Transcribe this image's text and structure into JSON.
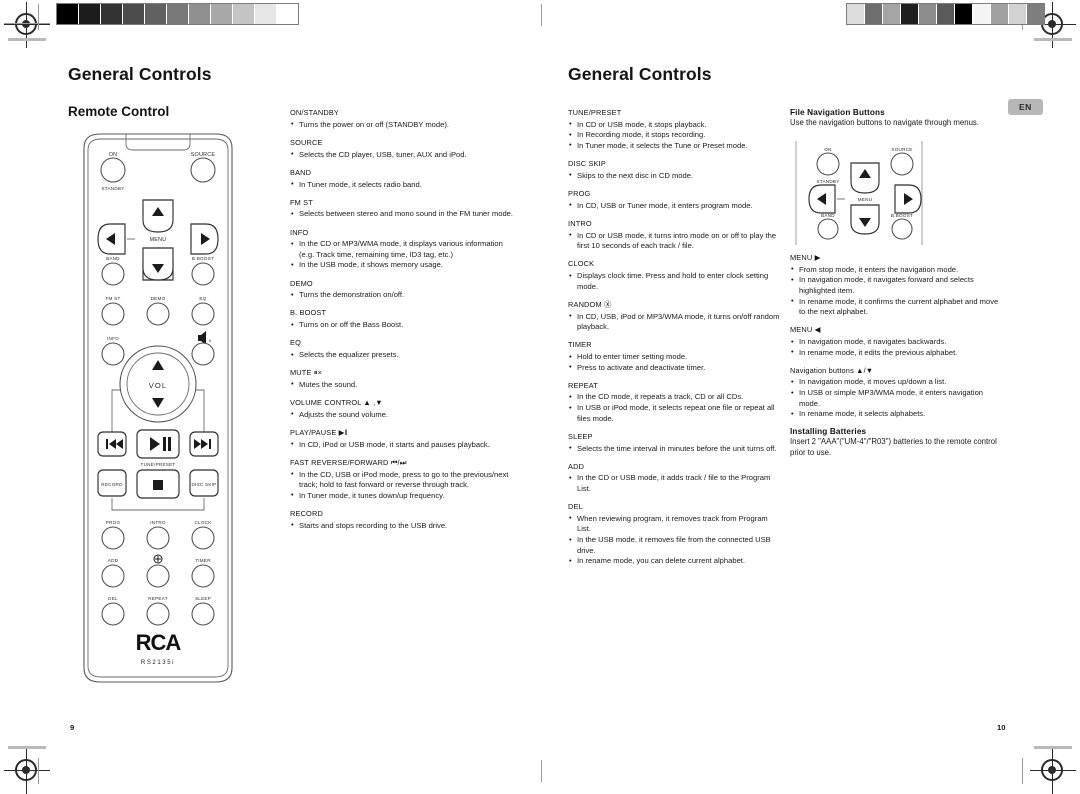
{
  "document": {
    "left_page_number": "9",
    "right_page_number": "10",
    "language_badge": "EN"
  },
  "left_page": {
    "title": "General Controls",
    "subtitle": "Remote Control",
    "remote": {
      "brand": "RCA",
      "model": "RS2135i",
      "labels": {
        "on": "ON",
        "standby": "STANDBY",
        "source": "SOURCE",
        "menu": "MENU",
        "band": "BAND",
        "bboost": "B.BOOST",
        "fmst": "FM ST",
        "demo": "DEMO",
        "eq": "EQ",
        "info": "INFO",
        "mute": "MUTE",
        "vol": "VOL",
        "tunepreset": "TUNE/PRESET",
        "record": "RECORD",
        "discskip": "DISC SKIP",
        "prog": "PROG",
        "intro": "INTRO",
        "clock": "CLOCK",
        "add": "ADD",
        "random": "RANDOM",
        "timer": "TIMER",
        "del": "DEL",
        "repeat": "REPEAT",
        "sleep": "SLEEP"
      }
    },
    "column1": [
      {
        "heading": "ON/STANDBY",
        "bullets": [
          "Turns the power on or off (STANDBY mode)."
        ]
      },
      {
        "heading": "SOURCE",
        "bullets": [
          "Selects the CD player, USB, tuner, AUX and iPod."
        ]
      },
      {
        "heading": "BAND",
        "bullets": [
          "In Tuner mode,  it selects radio band."
        ]
      },
      {
        "heading": "FM ST",
        "bullets": [
          "Selects between stereo and mono sound in the FM tuner mode."
        ]
      },
      {
        "heading": "INFO",
        "bullets": [
          "In the CD or MP3/WMA mode,  it displays various information (e.g. Track time, remaining time, ID3 tag, etc.)",
          "In the USB mode, it shows memory usage."
        ]
      },
      {
        "heading": "DEMO",
        "bullets": [
          "Turns the demonstration on/off."
        ]
      },
      {
        "heading": "B. BOOST",
        "bullets": [
          "Turns on or off the Bass Boost."
        ]
      },
      {
        "heading": "EQ",
        "bullets": [
          "Selects the equalizer presets."
        ]
      },
      {
        "heading": "MUTE ⏸×",
        "bullets": [
          "Mutes the sound."
        ]
      },
      {
        "heading": "VOLUME CONTROL ▲ ,▼",
        "bullets": [
          "Adjusts the sound volume."
        ]
      },
      {
        "heading": "PLAY/PAUSE ▶‖",
        "bullets": [
          "In CD, iPod or USB mode, it starts and pauses playback."
        ]
      },
      {
        "heading": "FAST REVERSE/FORWARD  ⏮/⏭",
        "bullets": [
          "In the CD, USB or iPod mode,  press to go to the previous/next track; hold to fast forward or reverse through track.",
          "In Tuner mode,  it tunes down/up frequency."
        ]
      },
      {
        "heading": "RECORD",
        "bullets": [
          "Starts and stops recording to the USB drive."
        ]
      }
    ]
  },
  "right_page": {
    "title": "General Controls",
    "column1": [
      {
        "heading": "TUNE/PRESET",
        "bullets": [
          "In CD or USB mode, it stops playback.",
          "In Recording mode,  it stops recording.",
          "In Tuner mode,  it selects the Tune or Preset mode."
        ]
      },
      {
        "heading": "DISC SKIP",
        "bullets": [
          "Skips to the next disc in CD mode."
        ]
      },
      {
        "heading": "PROG",
        "bullets": [
          "In CD, USB or Tuner mode, it enters program mode."
        ]
      },
      {
        "heading": "INTRO",
        "bullets": [
          "In CD or USB  mode, it turns intro mode on or off to play the first 10 seconds of each track / file."
        ]
      },
      {
        "heading": "CLOCK",
        "bullets": [
          "Displays clock time. Press and hold to enter clock setting mode."
        ]
      },
      {
        "heading": "RANDOM Ⓧ",
        "bullets": [
          "In CD, USB, iPod or MP3/WMA mode,  it turns on/off random playback."
        ]
      },
      {
        "heading": "TIMER",
        "bullets": [
          "Hold to enter timer setting mode.",
          "Press to activate and deactivate timer."
        ]
      },
      {
        "heading": "REPEAT",
        "bullets": [
          "In the CD mode,  it repeats a track, CD or all CDs.",
          "In USB or iPod mode,  it selects repeat one file or repeat all files mode."
        ]
      },
      {
        "heading": "SLEEP",
        "bullets": [
          "Selects the time interval in minutes before the unit turns off."
        ]
      },
      {
        "heading": "ADD",
        "bullets": [
          "In the CD or USB mode, it adds track / file to the Program List."
        ]
      },
      {
        "heading": "DEL",
        "bullets": [
          "When reviewing program, it removes track from Program List.",
          "In the USB mode, it removes file from the connected USB drive.",
          "In rename mode,  you can delete current alphabet."
        ]
      }
    ],
    "column2": {
      "file_nav_heading": "File Navigation Buttons",
      "file_nav_intro": "Use the navigation buttons to navigate through menus.",
      "diagram_labels": {
        "on": "ON",
        "standby": "STANDBY",
        "source": "SOURCE",
        "menu": "MENU",
        "band": "BAND",
        "bboost": "B.BOOST"
      },
      "groups": [
        {
          "heading": "MENU ▶",
          "bullets": [
            "From stop mode, it enters the navigation mode.",
            "In navigation mode,   it navigates forward and selects highlighted item.",
            "In rename mode,  it confirms the current alphabet and move to the next alphabet."
          ]
        },
        {
          "heading": "MENU ◀",
          "bullets": [
            "In navigation mode,   it navigates backwards.",
            "In rename mode,  it edits the previous alphabet."
          ]
        },
        {
          "heading": "Navigation buttons ▲/▼",
          "bullets": [
            "In navigation mode,   it moves up/down a list.",
            "In USB or simple MP3/WMA mode,   it enters navigation mode.",
            "In rename mode,  it selects alphabets."
          ]
        }
      ],
      "batteries_heading": "Installing Batteries",
      "batteries_text": "Insert 2 \"AAA\"(\"UM-4\"/\"R03\") batteries to the remote control prior to use."
    }
  },
  "color_bars": {
    "left_swatches": [
      "#000000",
      "#1c1c1c",
      "#333333",
      "#4b4b4b",
      "#616161",
      "#787878",
      "#909090",
      "#a8a8a8",
      "#c4c4c4",
      "#e6e6e6",
      "#ffffff"
    ],
    "right_swatches": [
      "#dcdcdc",
      "#6e6e6e",
      "#a5a5a5",
      "#1f1f1f",
      "#8c8c8c",
      "#5a5a5a",
      "#000000",
      "#f4f4f4",
      "#a0a0a0",
      "#d2d2d2",
      "#7e7e7e"
    ]
  }
}
